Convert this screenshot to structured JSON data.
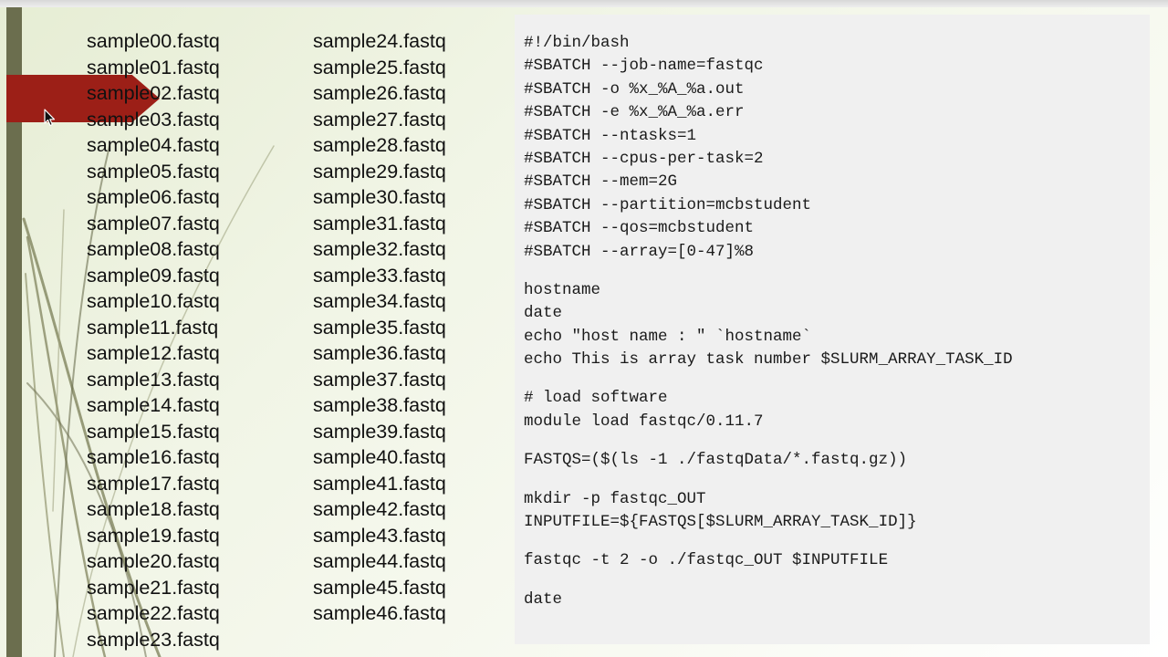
{
  "file_list": {
    "column_1": [
      "sample00.fastq",
      "sample01.fastq",
      "sample02.fastq",
      "sample03.fastq",
      "sample04.fastq",
      "sample05.fastq",
      "sample06.fastq",
      "sample07.fastq",
      "sample08.fastq",
      "sample09.fastq",
      "sample10.fastq",
      "sample11.fastq",
      "sample12.fastq",
      "sample13.fastq",
      "sample14.fastq",
      "sample15.fastq",
      "sample16.fastq",
      "sample17.fastq",
      "sample18.fastq",
      "sample19.fastq",
      "sample20.fastq",
      "sample21.fastq",
      "sample22.fastq",
      "sample23.fastq"
    ],
    "column_2": [
      "sample24.fastq",
      "sample25.fastq",
      "sample26.fastq",
      "sample27.fastq",
      "sample28.fastq",
      "sample29.fastq",
      "sample30.fastq",
      "sample31.fastq",
      "sample32.fastq",
      "sample33.fastq",
      "sample34.fastq",
      "sample35.fastq",
      "sample36.fastq",
      "sample37.fastq",
      "sample38.fastq",
      "sample39.fastq",
      "sample40.fastq",
      "sample41.fastq",
      "sample42.fastq",
      "sample43.fastq",
      "sample44.fastq",
      "sample45.fastq",
      "sample46.fastq"
    ]
  },
  "script": {
    "blocks": [
      [
        "#!/bin/bash",
        "#SBATCH --job-name=fastqc",
        "#SBATCH -o %x_%A_%a.out",
        "#SBATCH -e %x_%A_%a.err",
        "#SBATCH --ntasks=1",
        "#SBATCH --cpus-per-task=2",
        "#SBATCH --mem=2G",
        "#SBATCH --partition=mcbstudent",
        "#SBATCH --qos=mcbstudent",
        "#SBATCH --array=[0-47]%8"
      ],
      [
        "hostname",
        "date",
        "echo \"host name : \" `hostname`",
        "echo This is array task number $SLURM_ARRAY_TASK_ID"
      ],
      [
        "# load software",
        "module load fastqc/0.11.7"
      ],
      [
        "FASTQS=($(ls -1 ./fastqData/*.fastq.gz))"
      ],
      [
        "mkdir -p fastqc_OUT",
        "INPUTFILE=${FASTQS[$SLURM_ARRAY_TASK_ID]}"
      ],
      [
        "fastqc -t 2 -o ./fastqc_OUT $INPUTFILE"
      ],
      [
        "date"
      ]
    ]
  },
  "colors": {
    "accent_red": "#9c1f17",
    "side_bar": "#6b6e4e",
    "code_background": "#f0f0f0"
  },
  "icons": {
    "pointer": "mouse-cursor-icon",
    "highlight": "arrow-pointer-icon"
  }
}
